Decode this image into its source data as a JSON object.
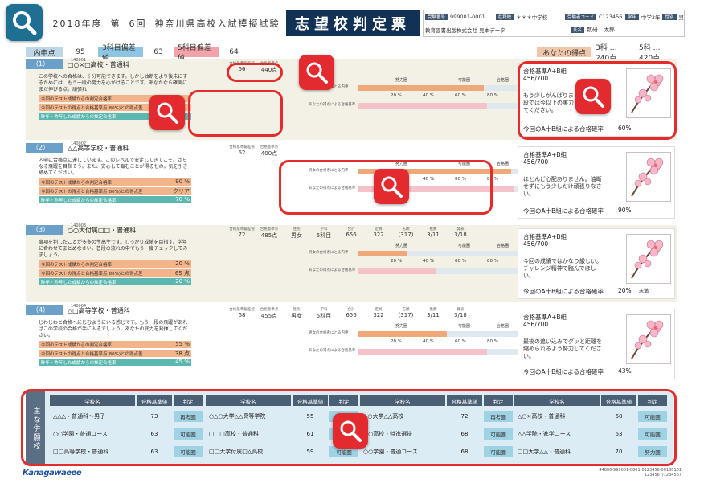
{
  "header": {
    "year": "2018年度",
    "round_label": "第",
    "round_no": "6回",
    "exam_name": "神奈川県高校入試模擬試験",
    "doc_title": "志望校判定票",
    "info": {
      "id_tag": "受験番号",
      "id_value": "999001-0001",
      "school_tag": "在籍校",
      "school_value": "＊＊＊中学校",
      "code_tag": "受験者コード",
      "code_value": "C123456",
      "grade_tag": "学年",
      "grade_value": "中学3年",
      "gender_tag": "性別",
      "gender_value": "男",
      "publisher": "教育図書出版株式会社 見本データ",
      "name_tag": "氏名",
      "name_value": "数研　太郎"
    }
  },
  "summary": {
    "score_label": "内申点",
    "score_value": "95",
    "dev3_label": "3科目偏差値",
    "dev3_value": "63",
    "dev5_label": "5科目偏差値",
    "dev5_value": "64",
    "mine_label": "あなたの得点",
    "mine3": "3科 … 240点",
    "mine5": "5科 … 420点"
  },
  "schools": [
    {
      "no": "（1）",
      "code": "140001",
      "name": "□○×□高校・普通科",
      "note": "この学校への合格は、十分可能できます。しかし油断をより後未にするためには、もう一段の努力を心がけることです。あなたなら確実にまだ伸びる点。頑張れ！",
      "rates": [
        {
          "label": "今回のテスト成績からの判定合格率",
          "value": ""
        },
        {
          "label": "今回のテストの得点と合格基準点(80%)との得点差",
          "value": ""
        },
        {
          "label": "昨年・昨年した成績からの推定合格率",
          "value": ""
        }
      ],
      "stats": {
        "h1": "合格基準偏差値",
        "h2": "合格基準点",
        "v1": "66",
        "v2": "440点"
      },
      "bars": {
        "a_label": "男女の合格者にとる内申",
        "b_label": "あなたの得点による合格基準"
      },
      "cand_title": "合格基準A+B組",
      "cand_score": "456/700",
      "cand_msg": "もう少しがんばりましょう！一段では今以上の実力を発揮させてください。",
      "cand_prob_label": "今回のA十B組による合格確率",
      "cand_prob": "60%"
    },
    {
      "no": "（2）",
      "code": "140002",
      "name": "△△高等学校・普通科",
      "note": "内申に合格点に達しています。このレベルで安定してきてこそ、さらなる飛躍を目指そう。また、安心して臨むことが得るもの。気を引き締めてください。",
      "rates": [
        {
          "label": "今回のテスト成績からの判定合格率",
          "value": "90 %"
        },
        {
          "label": "今回のテストの得点と合格基準点(80%)との得点差",
          "value": "クリア"
        },
        {
          "label": "昨年・昨年した成績からの推定合格率",
          "value": "70 %"
        }
      ],
      "stats": {
        "h1": "合格基準偏差値",
        "h2": "合格基準点",
        "v1": "62",
        "v2": "400点"
      },
      "bars": {
        "a_label": "男女の合格者にとる内申",
        "b_label": "あなたの得点による合格基準"
      },
      "cand_title": "合格基準A+B組",
      "cand_score": "456/700",
      "cand_msg": "ほとんど心配ありません。油断せずにもう少しだけ頑張りなさい。",
      "cand_prob_label": "今回のA十B組による合格確率",
      "cand_prob": "90%"
    },
    {
      "no": "（3）",
      "code": "140003",
      "name": "○○大付属□□・普通科",
      "note": "事項を判したことが多多の生高生です。しっかり成績を目指す。学年に合わせてまとめなさい。普段の流れの中でもう一度チェックしてみましょう。",
      "rates": [
        {
          "label": "今回のテスト成績からの判定合格率",
          "value": "20 %"
        },
        {
          "label": "今回のテストの得点と合格基準点(80%)との得点差",
          "value": "65 点"
        },
        {
          "label": "昨年・昨年した成績からの推定合格率",
          "value": "20 %"
        }
      ],
      "stats": {
        "h1": "合格基準偏差値",
        "h2": "合格基準点",
        "v1": "72",
        "v2": "485点",
        "h3": "性別",
        "v3": "男女",
        "h4": "学科",
        "v4": "5科目",
        "h5": "合計",
        "v5": "656",
        "h6": "定員",
        "v6": "322",
        "h7": "志願",
        "v7": "(317)",
        "h8": "推薦",
        "v8": "3/11",
        "h9": "発表",
        "v9": "3/18"
      },
      "bars": {
        "a_label": "男女の合格者にとる内申",
        "b_label": "あなたの得点による合格基準"
      },
      "cand_title": "合格基準A+B組",
      "cand_score": "456/700",
      "cand_msg": "今回の成績ではかなり厳しい。チャレンジ精神で臨んでほしい。",
      "cand_prob_label": "今回のA十B組による合格確率",
      "cand_prob": "20%",
      "cand_note": "未満"
    },
    {
      "no": "（4）",
      "code": "140004",
      "name": "△□高等学校・普通科",
      "note": "じわじわと合格へにじむようにいる感じです。もう一段の飛躍があればこの学校の合格が手に入るでしょう。あなたの底力を発揮してください。",
      "rates": [
        {
          "label": "今回のテスト成績からの判定合格率",
          "value": "55 %"
        },
        {
          "label": "今回のテストの得点と合格基準点(80%)との得点差",
          "value": "38 点"
        },
        {
          "label": "昨年・昨年した成績からの推定合格率",
          "value": "45 %"
        }
      ],
      "stats": {
        "h1": "合格基準偏差値",
        "h2": "合格基準点",
        "v1": "68",
        "v2": "455点",
        "h3": "性別",
        "v3": "男女",
        "h4": "学科",
        "v4": "5科目",
        "h5": "合計",
        "v5": "656",
        "h6": "定員",
        "v6": "322",
        "h7": "志願",
        "v7": "(317)",
        "h8": "推薦",
        "v8": "3/11",
        "h9": "発表",
        "v9": "3/18"
      },
      "bars": {
        "a_label": "男女の合格者にとる内申",
        "b_label": "あなたの得点による合格基準"
      },
      "cand_title": "合格基準A+B組",
      "cand_score": "456/700",
      "cand_msg": "最後の追い込みでグッと距離を縮められるよう努力してください。",
      "cand_prob_label": "今回のA十B組による合格確率",
      "cand_prob": "43%"
    }
  ],
  "zones": {
    "z1": "努力圏",
    "z2": "可能圏",
    "z3": "合格圏",
    "z0": "再考圏",
    "p20": "20 %",
    "p40": "40 %",
    "p60": "60 %",
    "p80": "80 %"
  },
  "other_schools": {
    "label": "主な併願校",
    "headers": {
      "name": "学校名",
      "dev": "合格基準値",
      "judge": "判定"
    },
    "rows": [
      [
        {
          "name": "△△△・普通科〜男子",
          "dev": "73",
          "judge": "再考圏"
        },
        {
          "name": "○△○大学△△高等学院",
          "dev": "55",
          "judge": ""
        },
        {
          "name": "△○大学△△高校",
          "dev": "72",
          "judge": "再考圏"
        },
        {
          "name": "△○×高校・普通科",
          "dev": "68",
          "judge": "可能圏"
        }
      ],
      [
        {
          "name": "○○学園・普通コース",
          "dev": "63",
          "judge": "可能圏"
        },
        {
          "name": "□□□高校・普通科",
          "dev": "61",
          "judge": ""
        },
        {
          "name": "○○高校・特進選抜",
          "dev": "68",
          "judge": "可能圏"
        },
        {
          "name": "△△学院・進学コース",
          "dev": "63",
          "judge": "可能圏"
        }
      ],
      [
        {
          "name": "□□高等学校・普通科",
          "dev": "63",
          "judge": "可能圏"
        },
        {
          "name": "□□大学付属□△高校",
          "dev": "59",
          "judge": "可能圏"
        },
        {
          "name": "○○学園・普通コース",
          "dev": "68",
          "judge": "可能圏"
        },
        {
          "name": "□□大学△△・普通科",
          "dev": "70",
          "judge": "努力圏"
        }
      ]
    ]
  },
  "footer": {
    "brand": "Kanagawaeee",
    "code1": "44606-999001-0001-0123456-00180101",
    "code2": "1234567/1234567"
  }
}
